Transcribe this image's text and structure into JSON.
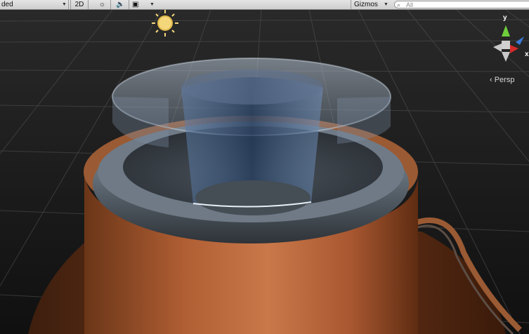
{
  "toolbar": {
    "shading_mode": "ded",
    "btn_2d": "2D",
    "light_icon": "sun-icon",
    "audio_icon": "speaker-icon",
    "effects_icon": "image-icon",
    "gizmos_label": "Gizmos",
    "search_placeholder": "All"
  },
  "orientation": {
    "y_label": "y",
    "x_label": "x",
    "projection_label": "‹ Persp"
  },
  "colors": {
    "y_axis": "#6fcf3a",
    "x_axis": "#d32a2a",
    "z_axis": "#3a78d6"
  }
}
